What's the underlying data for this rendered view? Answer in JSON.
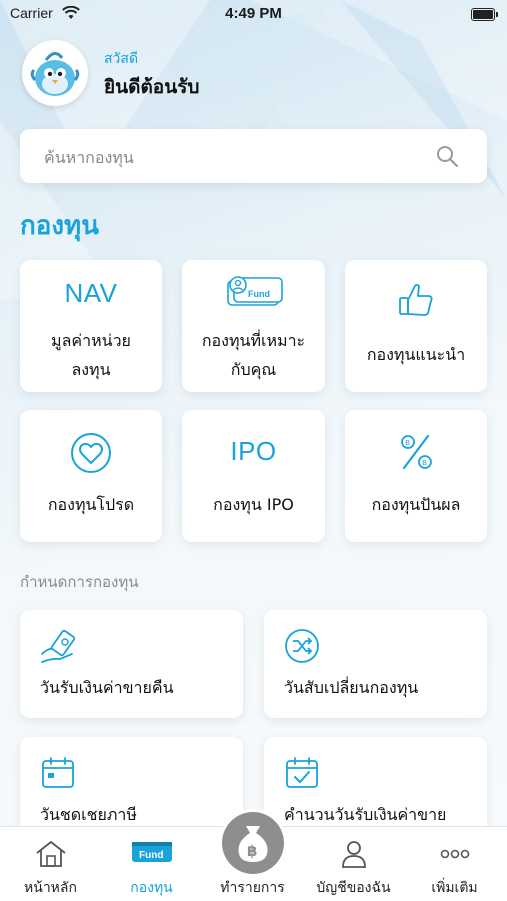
{
  "status": {
    "carrier": "Carrier",
    "time": "4:49 PM"
  },
  "header": {
    "greeting_small": "สวัสดี",
    "greeting_big": "ยินดีต้อนรับ"
  },
  "search": {
    "placeholder": "ค้นหากองทุน"
  },
  "section_title": "กองทุน",
  "fund_menu": [
    {
      "icon_text": "NAV",
      "label_line1": "มูลค่าหน่วย",
      "label_line2": "ลงทุน",
      "icon": "nav-icon"
    },
    {
      "icon_text": "Fund",
      "label_line1": "กองทุนที่เหมาะ",
      "label_line2": "กับคุณ",
      "icon": "fund-card-icon"
    },
    {
      "label_line1": "กองทุนแนะนำ",
      "icon": "thumbs-up-icon"
    },
    {
      "label_line1": "กองทุนโปรด",
      "icon": "heart-icon"
    },
    {
      "icon_text": "IPO",
      "label_line1": "กองทุน IPO",
      "icon": "ipo-icon"
    },
    {
      "label_line1": "กองทุนปันผล",
      "icon": "percent-icon"
    }
  ],
  "schedule_title": "กำหนดการกองทุน",
  "schedule_menu": [
    {
      "label": "วันรับเงินค่าขายคืน",
      "icon": "hand-money-icon"
    },
    {
      "label": "วันสับเปลี่ยนกองทุน",
      "icon": "shuffle-icon"
    },
    {
      "label": "วันชดเชยภาษี",
      "icon": "calendar-icon"
    },
    {
      "label": "คำนวนวันรับเงินค่าขาย",
      "icon": "calendar-check-icon"
    }
  ],
  "tabbar": [
    {
      "label": "หน้าหลัก",
      "icon": "home-icon",
      "active": false
    },
    {
      "label": "กองทุน",
      "icon": "fund-tab-icon",
      "active": true,
      "icon_text": "Fund"
    },
    {
      "label": "ทำรายการ",
      "icon": "baht-bag-icon",
      "active": false
    },
    {
      "label": "บัญชีของฉัน",
      "icon": "user-icon",
      "active": false
    },
    {
      "label": "เพิ่มเติม",
      "icon": "more-icon",
      "active": false
    }
  ],
  "colors": {
    "accent": "#1aa3d8",
    "tab_center": "#8e8e8e"
  }
}
